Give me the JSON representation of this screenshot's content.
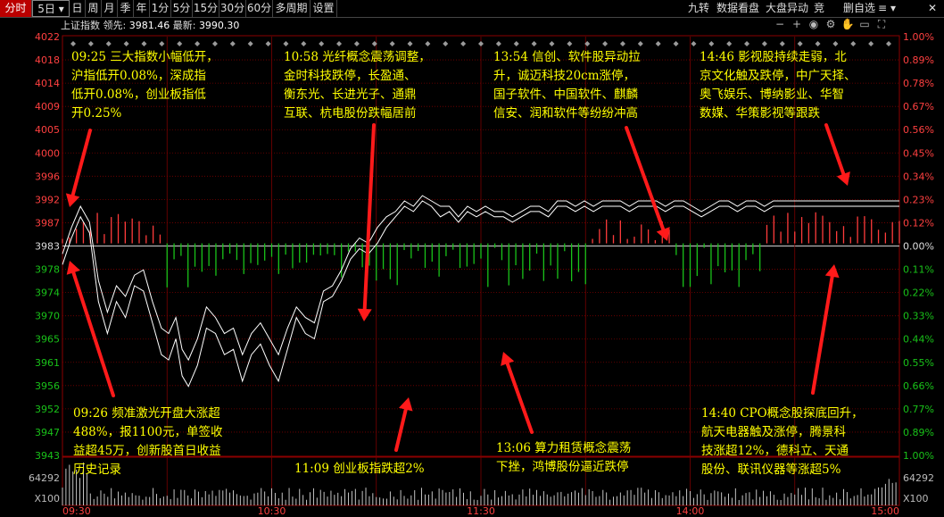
{
  "toolbar": {
    "tabs": [
      {
        "label": "分时",
        "active": true
      },
      {
        "label": "5日 ▾",
        "dropdown": true
      },
      {
        "label": "日"
      },
      {
        "label": "周"
      },
      {
        "label": "月"
      },
      {
        "label": "季"
      },
      {
        "label": "年"
      },
      {
        "label": "1分"
      },
      {
        "label": "5分"
      },
      {
        "label": "15分"
      },
      {
        "label": "30分"
      },
      {
        "label": "60分"
      },
      {
        "label": "多周期"
      },
      {
        "label": "设置"
      }
    ],
    "right_items": [
      "九转",
      "数据看盘",
      "大盘异动",
      "竞",
      "删自选"
    ],
    "menu_icon": "≡",
    "dropdown_icon": "▾"
  },
  "info": {
    "name": "上证指数",
    "lead_label": "领先:",
    "lead_value": "3981.46",
    "latest_label": "最新:",
    "latest_value": "3990.30"
  },
  "chart_icons": [
    "zoom-out-icon",
    "zoom-in-icon",
    "eye-icon",
    "settings-icon",
    "hand-icon",
    "ruler-icon",
    "fullscreen-icon"
  ],
  "chart_data": {
    "type": "line",
    "y_axis_ticks_left": [
      "4022",
      "4018",
      "4014",
      "4009",
      "4005",
      "4000",
      "3996",
      "3992",
      "3987",
      "3983",
      "3978",
      "3974",
      "3970",
      "3965",
      "3961",
      "3956",
      "3952",
      "3947",
      "3943"
    ],
    "y_axis_ticks_right": [
      "1.00%",
      "0.89%",
      "0.78%",
      "0.67%",
      "0.56%",
      "0.45%",
      "0.34%",
      "0.23%",
      "0.12%",
      "0.00%",
      "0.11%",
      "0.22%",
      "0.33%",
      "0.44%",
      "0.55%",
      "0.66%",
      "0.77%",
      "0.89%",
      "1.00%"
    ],
    "ylim": [
      3943,
      4022
    ],
    "prev_close": 3983,
    "x_ticks": [
      "09:30",
      "10:30",
      "11:30",
      "14:00",
      "15:00"
    ],
    "series": [
      {
        "name": "",
        "color": "#ffffff",
        "points": [
          [
            0,
            3979
          ],
          [
            10,
            3984
          ],
          [
            20,
            3988
          ],
          [
            30,
            3985
          ],
          [
            40,
            3972
          ],
          [
            50,
            3966
          ],
          [
            60,
            3972
          ],
          [
            70,
            3969
          ],
          [
            80,
            3975
          ],
          [
            90,
            3974
          ],
          [
            100,
            3968
          ],
          [
            110,
            3962
          ],
          [
            118,
            3961
          ],
          [
            126,
            3965
          ],
          [
            133,
            3958
          ],
          [
            140,
            3956
          ],
          [
            150,
            3960
          ],
          [
            160,
            3967
          ],
          [
            170,
            3966
          ],
          [
            180,
            3962
          ],
          [
            190,
            3963
          ],
          [
            200,
            3957
          ],
          [
            210,
            3962
          ],
          [
            220,
            3964
          ],
          [
            230,
            3960
          ],
          [
            240,
            3957
          ],
          [
            250,
            3963
          ],
          [
            260,
            3969
          ],
          [
            270,
            3966
          ],
          [
            280,
            3965
          ],
          [
            290,
            3972
          ],
          [
            300,
            3973
          ],
          [
            310,
            3976
          ],
          [
            320,
            3980
          ],
          [
            330,
            3982
          ],
          [
            340,
            3981
          ],
          [
            350,
            3983
          ],
          [
            360,
            3986
          ],
          [
            370,
            3988
          ],
          [
            380,
            3990
          ],
          [
            390,
            3989
          ],
          [
            400,
            3991
          ],
          [
            410,
            3990
          ],
          [
            420,
            3988
          ],
          [
            430,
            3989
          ],
          [
            440,
            3987
          ],
          [
            450,
            3989
          ],
          [
            460,
            3988
          ],
          [
            470,
            3989
          ],
          [
            480,
            3988
          ],
          [
            490,
            3988
          ],
          [
            500,
            3987
          ],
          [
            510,
            3988
          ],
          [
            520,
            3989
          ],
          [
            530,
            3989
          ],
          [
            540,
            3988
          ],
          [
            550,
            3990
          ],
          [
            560,
            3990
          ],
          [
            570,
            3989
          ],
          [
            580,
            3990
          ],
          [
            590,
            3989
          ],
          [
            600,
            3990
          ],
          [
            610,
            3990
          ],
          [
            620,
            3990
          ],
          [
            630,
            3989
          ],
          [
            640,
            3990
          ],
          [
            650,
            3990
          ],
          [
            660,
            3990
          ],
          [
            670,
            3989
          ],
          [
            680,
            3990
          ],
          [
            690,
            3990
          ],
          [
            700,
            3989
          ],
          [
            710,
            3988
          ],
          [
            720,
            3989
          ],
          [
            730,
            3990
          ],
          [
            740,
            3990
          ],
          [
            750,
            3989
          ],
          [
            760,
            3990
          ],
          [
            770,
            3990
          ],
          [
            780,
            3989
          ],
          [
            790,
            3990
          ],
          [
            800,
            3990
          ],
          [
            810,
            3990
          ],
          [
            820,
            3990
          ],
          [
            830,
            3990
          ],
          [
            840,
            3990
          ],
          [
            850,
            3990
          ],
          [
            860,
            3990
          ],
          [
            870,
            3990
          ],
          [
            880,
            3990
          ],
          [
            890,
            3990
          ],
          [
            900,
            3990
          ],
          [
            910,
            3990
          ],
          [
            920,
            3990
          ],
          [
            930,
            3990
          ]
        ]
      },
      {
        "name": "",
        "color": "#ffffff",
        "points": [
          [
            0,
            3981
          ],
          [
            10,
            3986
          ],
          [
            20,
            3990
          ],
          [
            30,
            3987
          ],
          [
            40,
            3976
          ],
          [
            50,
            3970
          ],
          [
            60,
            3975
          ],
          [
            70,
            3973
          ],
          [
            80,
            3977
          ],
          [
            90,
            3978
          ],
          [
            100,
            3972
          ],
          [
            110,
            3967
          ],
          [
            118,
            3966
          ],
          [
            126,
            3969
          ],
          [
            133,
            3963
          ],
          [
            140,
            3961
          ],
          [
            150,
            3965
          ],
          [
            160,
            3971
          ],
          [
            170,
            3969
          ],
          [
            180,
            3966
          ],
          [
            190,
            3967
          ],
          [
            200,
            3962
          ],
          [
            210,
            3966
          ],
          [
            220,
            3968
          ],
          [
            230,
            3965
          ],
          [
            240,
            3962
          ],
          [
            250,
            3967
          ],
          [
            260,
            3971
          ],
          [
            270,
            3969
          ],
          [
            280,
            3968
          ],
          [
            290,
            3974
          ],
          [
            300,
            3975
          ],
          [
            310,
            3978
          ],
          [
            320,
            3982
          ],
          [
            330,
            3984
          ],
          [
            340,
            3983
          ],
          [
            350,
            3986
          ],
          [
            360,
            3988
          ],
          [
            370,
            3989
          ],
          [
            380,
            3991
          ],
          [
            390,
            3990
          ],
          [
            400,
            3992
          ],
          [
            410,
            3991
          ],
          [
            420,
            3990
          ],
          [
            430,
            3990
          ],
          [
            440,
            3988
          ],
          [
            450,
            3990
          ],
          [
            460,
            3989
          ],
          [
            470,
            3990
          ],
          [
            480,
            3989
          ],
          [
            490,
            3989
          ],
          [
            500,
            3988
          ],
          [
            510,
            3989
          ],
          [
            520,
            3990
          ],
          [
            530,
            3990
          ],
          [
            540,
            3989
          ],
          [
            550,
            3991
          ],
          [
            560,
            3991
          ],
          [
            570,
            3990
          ],
          [
            580,
            3991
          ],
          [
            590,
            3990
          ],
          [
            600,
            3991
          ],
          [
            610,
            3991
          ],
          [
            620,
            3991
          ],
          [
            630,
            3990
          ],
          [
            640,
            3991
          ],
          [
            650,
            3991
          ],
          [
            660,
            3991
          ],
          [
            670,
            3990
          ],
          [
            680,
            3991
          ],
          [
            690,
            3991
          ],
          [
            700,
            3990
          ],
          [
            710,
            3989
          ],
          [
            720,
            3990
          ],
          [
            730,
            3991
          ],
          [
            740,
            3991
          ],
          [
            750,
            3990
          ],
          [
            760,
            3991
          ],
          [
            770,
            3991
          ],
          [
            780,
            3990
          ],
          [
            790,
            3991
          ],
          [
            800,
            3991
          ],
          [
            810,
            3991
          ],
          [
            820,
            3991
          ],
          [
            830,
            3991
          ],
          [
            840,
            3991
          ],
          [
            850,
            3991
          ],
          [
            860,
            3991
          ],
          [
            870,
            3991
          ],
          [
            880,
            3991
          ],
          [
            890,
            3991
          ],
          [
            900,
            3991
          ],
          [
            910,
            3991
          ],
          [
            920,
            3991
          ],
          [
            930,
            3991
          ]
        ]
      }
    ],
    "volume_label": "64292",
    "volume_unit": "X100",
    "volume_label_right": "64292",
    "volume_unit_right": "X100"
  },
  "annotations": [
    {
      "id": "a1",
      "text": "09:25 三大指数小幅低开，\n沪指低开0.08%，深成指\n低开0.08%，创业板指低\n开0.25%"
    },
    {
      "id": "a2",
      "text": "10:58 光纤概念震荡调整，\n金时科技跌停，长盈通、\n衡东光、长进光子、通鼎\n互联、杭电股份跌幅居前"
    },
    {
      "id": "a3",
      "text": "13:54 信创、软件股异动拉\n升，诚迈科技20cm涨停，\n国子软件、中国软件、麒麟\n信安、润和软件等纷纷冲高"
    },
    {
      "id": "a4",
      "text": "14:46 影视股持续走弱，北\n京文化触及跌停，中广天择、\n奥飞娱乐、博纳影业、华智\n数媒、华策影视等跟跌"
    },
    {
      "id": "a5",
      "text": "09:26 频准激光开盘大涨超\n488%，报1100元，单签收\n益超45万，创新股首日收益\n历史记录"
    },
    {
      "id": "a6",
      "text": "11:09 创业板指跌超2%"
    },
    {
      "id": "a7",
      "text": "13:06 算力租赁概念震荡\n下挫，鸿博股份逼近跌停"
    },
    {
      "id": "a8",
      "text": "14:40 CPO概念股探底回升，\n航天电器触及涨停，腾景科\n技涨超12%，德科立、天通\n股份、联讯仪器等涨超5%"
    }
  ],
  "colors": {
    "up": "#ff3b3b",
    "down": "#19c219",
    "price_line": "#ffffff",
    "avg_line": "#ffff00",
    "annotation": "#ffff00",
    "arrow": "#ff1a1a",
    "grid": "#8b0000"
  }
}
